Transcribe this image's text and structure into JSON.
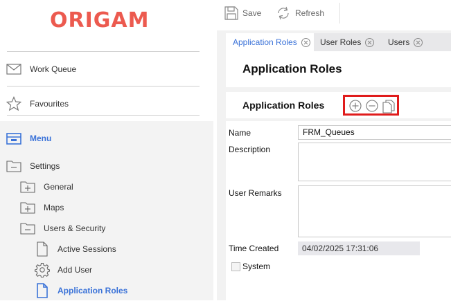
{
  "app": {
    "logo_text": "ORIGAM",
    "brand_color": "#ec5a4f",
    "accent_color": "#3a72d8"
  },
  "sidebar": {
    "top_items": [
      {
        "label": "Work Queue",
        "icon": "mail-icon"
      },
      {
        "label": "Favourites",
        "icon": "star-icon"
      }
    ],
    "menu": {
      "label": "Menu",
      "icon": "menu-drawer-icon"
    },
    "tree": [
      {
        "label": "Settings",
        "icon": "folder-collapse-icon"
      },
      {
        "label": "General",
        "icon": "folder-expand-icon"
      },
      {
        "label": "Maps",
        "icon": "folder-expand-icon"
      },
      {
        "label": "Users & Security",
        "icon": "folder-collapse-icon"
      },
      {
        "label": "Active Sessions",
        "icon": "document-icon"
      },
      {
        "label": "Add User",
        "icon": "gear-icon"
      },
      {
        "label": "Application Roles",
        "icon": "document-icon"
      }
    ]
  },
  "toolbar": {
    "save_label": "Save",
    "refresh_label": "Refresh"
  },
  "tabs": [
    {
      "label": "Application Roles"
    },
    {
      "label": "User Roles"
    },
    {
      "label": "Users"
    }
  ],
  "screen": {
    "title": "Application Roles"
  },
  "section": {
    "title": "Application Roles",
    "actions": [
      "add-icon",
      "remove-icon",
      "copy-icon"
    ]
  },
  "form": {
    "name_label": "Name",
    "name_value": "FRM_Queues",
    "description_label": "Description",
    "description_value": "",
    "remarks_label": "User Remarks",
    "remarks_value": "",
    "time_created_label": "Time Created",
    "time_created_value": "04/02/2025 17:31:06",
    "system_label": "System",
    "system_checked": false
  }
}
